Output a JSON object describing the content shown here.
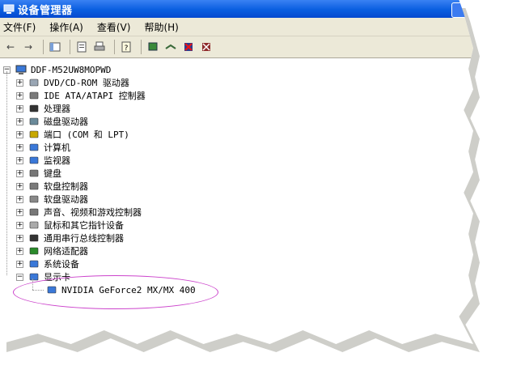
{
  "window": {
    "title": "设备管理器"
  },
  "menu": [
    "文件(F)",
    "操作(A)",
    "查看(V)",
    "帮助(H)"
  ],
  "tree": {
    "root": "DDF-M52UW8MOPWD",
    "categories": [
      "DVD/CD-ROM 驱动器",
      "IDE ATA/ATAPI 控制器",
      "处理器",
      "磁盘驱动器",
      "端口 (COM 和 LPT)",
      "计算机",
      "监视器",
      "键盘",
      "软盘控制器",
      "软盘驱动器",
      "声音、视频和游戏控制器",
      "鼠标和其它指针设备",
      "通用串行总线控制器",
      "网络适配器",
      "系统设备",
      "显示卡"
    ],
    "display_child": "NVIDIA GeForce2 MX/MX 400"
  }
}
